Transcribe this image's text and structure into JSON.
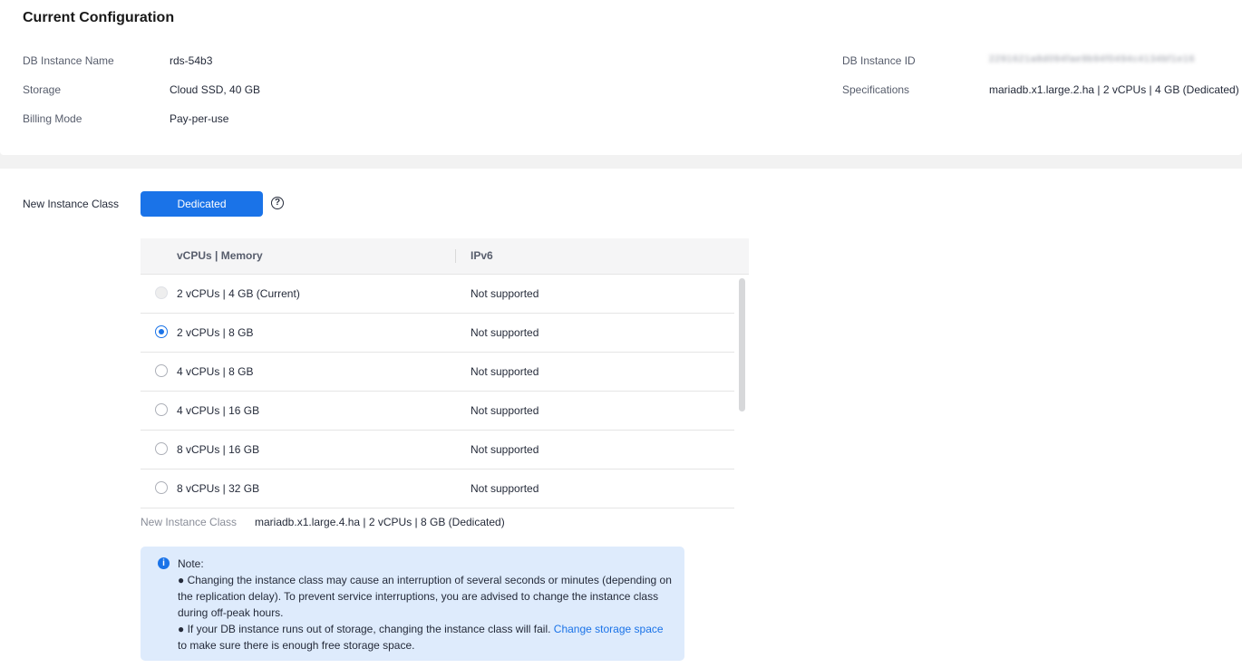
{
  "current_config": {
    "title": "Current Configuration",
    "instance_name_label": "DB Instance Name",
    "instance_name_value": "rds-54b3",
    "storage_label": "Storage",
    "storage_value": "Cloud SSD, 40 GB",
    "billing_label": "Billing Mode",
    "billing_value": "Pay-per-use",
    "instance_id_label": "DB Instance ID",
    "instance_id_value": "2291621a8d094fae9b94f0494c4134bf1e16",
    "spec_label": "Specifications",
    "spec_value": "mariadb.x1.large.2.ha | 2 vCPUs | 4 GB (Dedicated)"
  },
  "new_class": {
    "label": "New Instance Class",
    "dedicated_button": "Dedicated",
    "help_icon": "question-circle-icon",
    "help_glyph": "?",
    "table": {
      "col_spec": "vCPUs | Memory",
      "col_ipv6": "IPv6",
      "rows": [
        {
          "spec": "2 vCPUs | 4 GB (Current)",
          "ipv6": "Not supported",
          "state": "disabled"
        },
        {
          "spec": "2 vCPUs | 8 GB",
          "ipv6": "Not supported",
          "state": "checked"
        },
        {
          "spec": "4 vCPUs | 8 GB",
          "ipv6": "Not supported",
          "state": "unchecked"
        },
        {
          "spec": "4 vCPUs | 16 GB",
          "ipv6": "Not supported",
          "state": "unchecked"
        },
        {
          "spec": "8 vCPUs | 16 GB",
          "ipv6": "Not supported",
          "state": "unchecked"
        },
        {
          "spec": "8 vCPUs | 32 GB",
          "ipv6": "Not supported",
          "state": "unchecked"
        }
      ]
    },
    "summary_label": "New Instance Class",
    "summary_value": "mariadb.x1.large.4.ha | 2 vCPUs | 8 GB (Dedicated)"
  },
  "note": {
    "icon": "info-icon",
    "icon_glyph": "i",
    "title": "Note:",
    "line1": "● Changing the instance class may cause an interruption of several seconds or minutes (depending on the replication delay). To prevent service interruptions, you are advised to change the instance class during off-peak hours.",
    "line2_prefix": "● If your DB instance runs out of storage, changing the instance class will fail. ",
    "line2_link": "Change storage space",
    "line2_suffix": "to make sure there is enough free storage space."
  },
  "colors": {
    "primary": "#1a73e8",
    "note_bg": "#deebfc",
    "text": "#252b3a",
    "muted": "#575d6c"
  }
}
